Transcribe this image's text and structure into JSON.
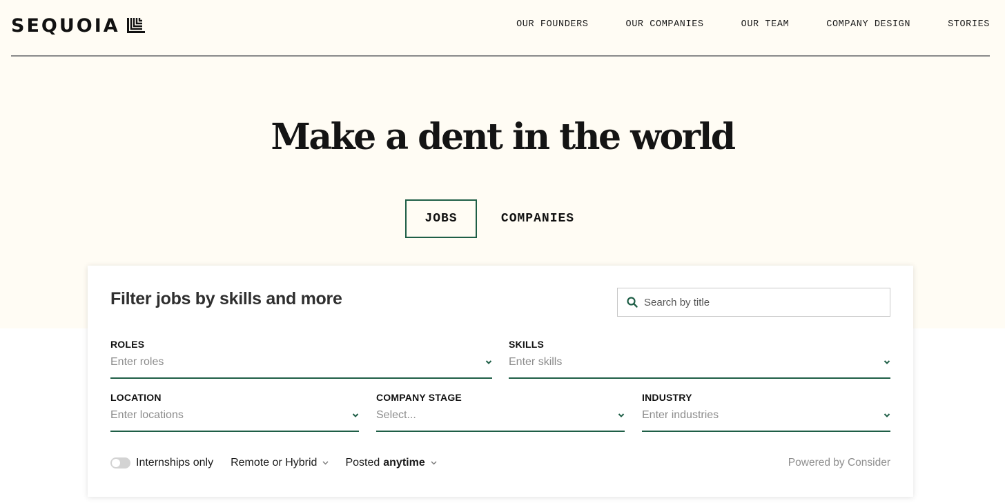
{
  "header": {
    "logo_text": "SEQUOIA",
    "nav": [
      "OUR FOUNDERS",
      "OUR COMPANIES",
      "OUR TEAM",
      "COMPANY DESIGN",
      "STORIES"
    ]
  },
  "hero": {
    "headline": "Make a dent in the world",
    "tabs": [
      {
        "label": "JOBS",
        "active": true
      },
      {
        "label": "COMPANIES",
        "active": false
      }
    ]
  },
  "filters": {
    "title": "Filter jobs by skills and more",
    "search_placeholder": "Search by title",
    "fields": [
      {
        "label": "ROLES",
        "placeholder": "Enter roles"
      },
      {
        "label": "SKILLS",
        "placeholder": "Enter skills"
      },
      {
        "label": "LOCATION",
        "placeholder": "Enter locations"
      },
      {
        "label": "COMPANY STAGE",
        "placeholder": "Select..."
      },
      {
        "label": "INDUSTRY",
        "placeholder": "Enter industries"
      }
    ],
    "internships_label": "Internships only",
    "internships_on": false,
    "remote_label": "Remote or Hybrid",
    "posted_prefix": "Posted",
    "posted_value": "anytime",
    "powered_by": "Powered by Consider"
  },
  "colors": {
    "accent": "#1e5e46",
    "hero_bg": "#fffcf4",
    "toggle_off": "#d3d3d3"
  },
  "icons": [
    "sequoia-logo-icon",
    "search-icon",
    "chevron-down-icon"
  ]
}
